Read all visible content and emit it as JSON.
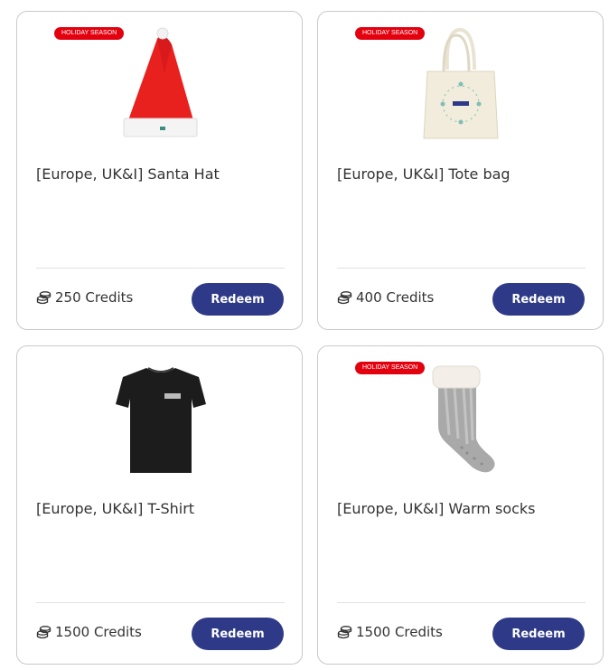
{
  "theme": {
    "button_color": "#2e3a87",
    "badge_color": "#e3000f"
  },
  "products": [
    {
      "badge": "HOLIDAY SEASON",
      "title": "[Europe, UK&I] Santa Hat",
      "credits": "250 Credits",
      "button": "Redeem",
      "image_icon": "santa-hat-image"
    },
    {
      "badge": "HOLIDAY SEASON",
      "title": "[Europe, UK&I] Tote bag",
      "credits": "400 Credits",
      "button": "Redeem",
      "image_icon": "tote-bag-image"
    },
    {
      "badge": "",
      "title": "[Europe, UK&I] T-Shirt",
      "credits": "1500 Credits",
      "button": "Redeem",
      "image_icon": "t-shirt-image"
    },
    {
      "badge": "HOLIDAY SEASON",
      "title": "[Europe, UK&I] Warm socks",
      "credits": "1500 Credits",
      "button": "Redeem",
      "image_icon": "warm-socks-image"
    }
  ]
}
